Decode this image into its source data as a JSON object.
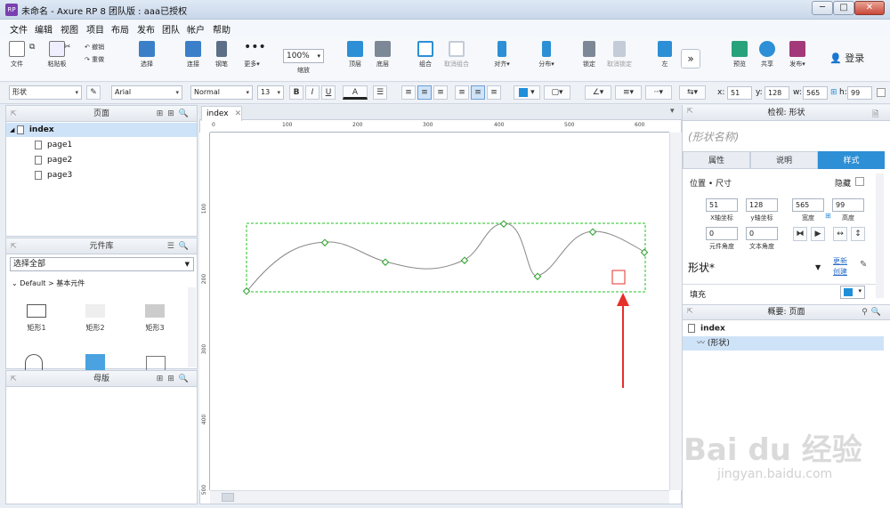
{
  "window": {
    "title": "未命名 - Axure RP 8 团队版 : aaa已授权",
    "app_icon": "RP",
    "controls": {
      "minimize": "─",
      "maximize": "□",
      "close": "✕"
    }
  },
  "menu": [
    "文件",
    "编辑",
    "视图",
    "项目",
    "布局",
    "发布",
    "团队",
    "帐户",
    "帮助"
  ],
  "toolbar": {
    "file": "文件",
    "paste": "粘贴板",
    "cut": "✂",
    "copy": "⧉",
    "undo": "撤销",
    "redo": "重做",
    "select": "选择",
    "connect": "连接",
    "pen": "钢笔",
    "more": "更多▾",
    "zoom": "100%",
    "zoom_label": "缩放",
    "front": "顶层",
    "back": "底层",
    "group": "组合",
    "ungroup": "取消组合",
    "align": "对齐▾",
    "distribute": "分布▾",
    "lock": "锁定",
    "unlock": "取消锁定",
    "left": "左",
    "overflow": "»",
    "preview": "预览",
    "share": "共享",
    "publish": "发布▾",
    "login": "登录"
  },
  "format": {
    "shape_type": "形状",
    "font": "Arial",
    "style": "Normal",
    "size": "13",
    "bold": "B",
    "italic": "I",
    "underline": "U",
    "font_color_label": "A",
    "x_label": "x:",
    "x": "51",
    "y_label": "y:",
    "y": "128",
    "w_label": "w:",
    "w": "565",
    "h_label": "h:",
    "h": "99"
  },
  "pages_panel": {
    "title": "页面",
    "root": "index",
    "pages": [
      "page1",
      "page2",
      "page3"
    ]
  },
  "library_panel": {
    "title": "元件库",
    "selector": "选择全部",
    "group": "Default > 基本元件",
    "widgets": [
      "矩形1",
      "矩形2",
      "矩形3"
    ]
  },
  "master_panel": {
    "title": "母版"
  },
  "canvas": {
    "tab": "index",
    "h_ticks": [
      "0",
      "100",
      "200",
      "300",
      "400",
      "500",
      "600"
    ],
    "v_ticks": [
      "100",
      "200",
      "300",
      "400",
      "500"
    ]
  },
  "inspector": {
    "title": "检视: 形状",
    "shape_name_placeholder": "(形状名称)",
    "tabs": [
      "属性",
      "说明",
      "样式"
    ],
    "position_size": "位置 • 尺寸",
    "hide": "隐藏",
    "x": "51",
    "y": "128",
    "w": "565",
    "h": "99",
    "x_lbl": "X轴坐标",
    "y_lbl": "y轴坐标",
    "w_lbl": "宽度",
    "h_lbl": "高度",
    "rot": "0",
    "text_rot": "0",
    "rot_lbl": "元件角度",
    "text_rot_lbl": "文本角度",
    "style_name": "形状*",
    "update": "更新",
    "create": "创建",
    "fill": "填充",
    "fill_color": "#1e8fd8"
  },
  "outline": {
    "title": "概要: 页面",
    "root": "index",
    "item": "(形状)"
  },
  "watermark": {
    "brand": "Bai du 经验",
    "url": "jingyan.baidu.com"
  },
  "colors": {
    "accent": "#2d8fd5",
    "selection": "#22c222",
    "annotation": "#e6302a"
  }
}
